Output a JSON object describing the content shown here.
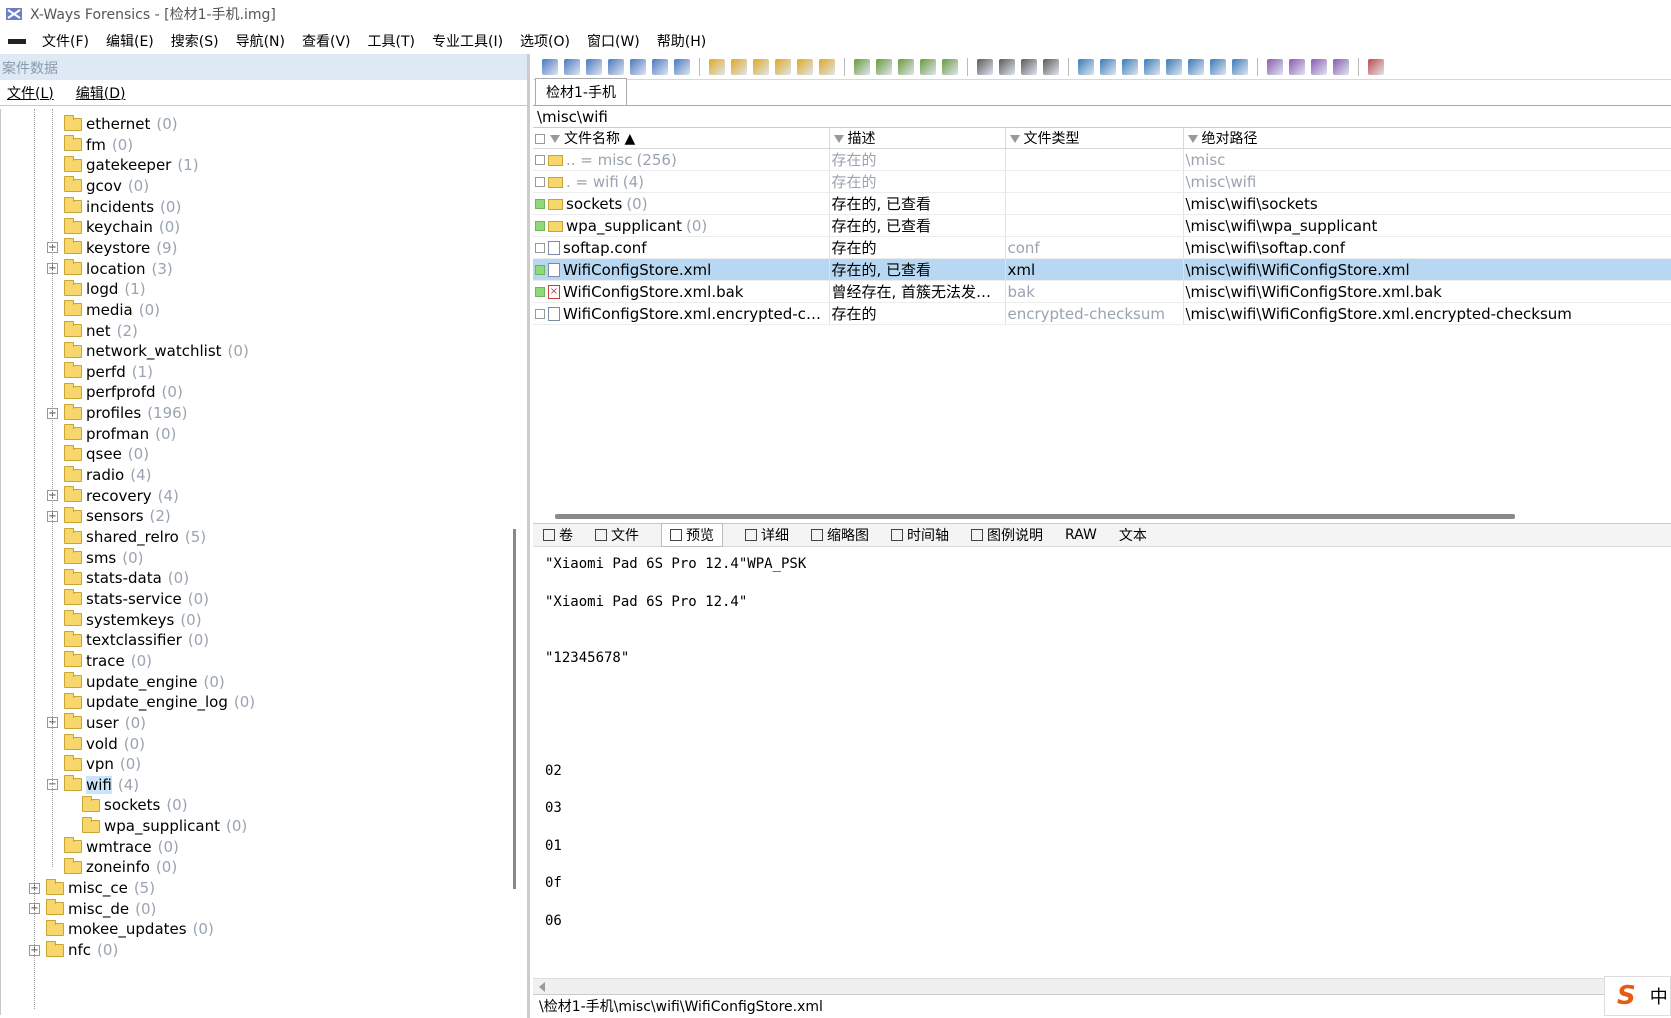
{
  "window": {
    "title": "X-Ways Forensics - [检材1-手机.img]"
  },
  "menu": [
    "文件(F)",
    "编辑(E)",
    "搜索(S)",
    "导航(N)",
    "查看(V)",
    "工具(T)",
    "专业工具(I)",
    "选项(O)",
    "窗口(W)",
    "帮助(H)"
  ],
  "case_panel": {
    "header": "案件数据",
    "menu": [
      "文件(L)",
      "编辑(D)"
    ]
  },
  "tree": [
    {
      "name": "ethernet",
      "count": "(0)",
      "level": 2,
      "expandable": false
    },
    {
      "name": "fm",
      "count": "(0)",
      "level": 2,
      "expandable": false
    },
    {
      "name": "gatekeeper",
      "count": "(1)",
      "level": 2,
      "expandable": false
    },
    {
      "name": "gcov",
      "count": "(0)",
      "level": 2,
      "expandable": false
    },
    {
      "name": "incidents",
      "count": "(0)",
      "level": 2,
      "expandable": false
    },
    {
      "name": "keychain",
      "count": "(0)",
      "level": 2,
      "expandable": false
    },
    {
      "name": "keystore",
      "count": "(9)",
      "level": 2,
      "expandable": true
    },
    {
      "name": "location",
      "count": "(3)",
      "level": 2,
      "expandable": true
    },
    {
      "name": "logd",
      "count": "(1)",
      "level": 2,
      "expandable": false
    },
    {
      "name": "media",
      "count": "(0)",
      "level": 2,
      "expandable": false
    },
    {
      "name": "net",
      "count": "(2)",
      "level": 2,
      "expandable": false
    },
    {
      "name": "network_watchlist",
      "count": "(0)",
      "level": 2,
      "expandable": false
    },
    {
      "name": "perfd",
      "count": "(1)",
      "level": 2,
      "expandable": false
    },
    {
      "name": "perfprofd",
      "count": "(0)",
      "level": 2,
      "expandable": false
    },
    {
      "name": "profiles",
      "count": "(196)",
      "level": 2,
      "expandable": true
    },
    {
      "name": "profman",
      "count": "(0)",
      "level": 2,
      "expandable": false
    },
    {
      "name": "qsee",
      "count": "(0)",
      "level": 2,
      "expandable": false
    },
    {
      "name": "radio",
      "count": "(4)",
      "level": 2,
      "expandable": false
    },
    {
      "name": "recovery",
      "count": "(4)",
      "level": 2,
      "expandable": true
    },
    {
      "name": "sensors",
      "count": "(2)",
      "level": 2,
      "expandable": true
    },
    {
      "name": "shared_relro",
      "count": "(5)",
      "level": 2,
      "expandable": false
    },
    {
      "name": "sms",
      "count": "(0)",
      "level": 2,
      "expandable": false
    },
    {
      "name": "stats-data",
      "count": "(0)",
      "level": 2,
      "expandable": false
    },
    {
      "name": "stats-service",
      "count": "(0)",
      "level": 2,
      "expandable": false
    },
    {
      "name": "systemkeys",
      "count": "(0)",
      "level": 2,
      "expandable": false
    },
    {
      "name": "textclassifier",
      "count": "(0)",
      "level": 2,
      "expandable": false
    },
    {
      "name": "trace",
      "count": "(0)",
      "level": 2,
      "expandable": false
    },
    {
      "name": "update_engine",
      "count": "(0)",
      "level": 2,
      "expandable": false
    },
    {
      "name": "update_engine_log",
      "count": "(0)",
      "level": 2,
      "expandable": false
    },
    {
      "name": "user",
      "count": "(0)",
      "level": 2,
      "expandable": true
    },
    {
      "name": "vold",
      "count": "(0)",
      "level": 2,
      "expandable": false
    },
    {
      "name": "vpn",
      "count": "(0)",
      "level": 2,
      "expandable": false
    },
    {
      "name": "wifi",
      "count": "(4)",
      "level": 2,
      "expandable": true,
      "expanded": true,
      "selected": true
    },
    {
      "name": "sockets",
      "count": "(0)",
      "level": 3,
      "expandable": false
    },
    {
      "name": "wpa_supplicant",
      "count": "(0)",
      "level": 3,
      "expandable": false
    },
    {
      "name": "wmtrace",
      "count": "(0)",
      "level": 2,
      "expandable": false
    },
    {
      "name": "zoneinfo",
      "count": "(0)",
      "level": 2,
      "expandable": false
    },
    {
      "name": "misc_ce",
      "count": "(5)",
      "level": 1,
      "expandable": true
    },
    {
      "name": "misc_de",
      "count": "(0)",
      "level": 1,
      "expandable": true
    },
    {
      "name": "mokee_updates",
      "count": "(0)",
      "level": 1,
      "expandable": false
    },
    {
      "name": "nfc",
      "count": "(0)",
      "level": 1,
      "expandable": true
    }
  ],
  "evidence_tab": "检材1-手机",
  "current_path": "\\misc\\wifi",
  "columns": [
    "文件名称",
    "描述",
    "文件类型",
    "绝对路径"
  ],
  "files": [
    {
      "name": "..  =  misc",
      "count": "(256)",
      "desc": "存在的",
      "type": "",
      "path": "\\misc",
      "grey": true,
      "icon": "folder",
      "check": ""
    },
    {
      "name": ".   =  wifi",
      "count": "(4)",
      "desc": "存在的",
      "type": "",
      "path": "\\misc\\wifi",
      "grey": true,
      "icon": "folder",
      "check": ""
    },
    {
      "name": "sockets",
      "count": "(0)",
      "desc": "存在的, 已查看",
      "type": "",
      "path": "\\misc\\wifi\\sockets",
      "grey": false,
      "icon": "folder",
      "check": "green"
    },
    {
      "name": "wpa_supplicant",
      "count": "(0)",
      "desc": "存在的, 已查看",
      "type": "",
      "path": "\\misc\\wifi\\wpa_supplicant",
      "grey": false,
      "icon": "folder",
      "check": "green"
    },
    {
      "name": "softap.conf",
      "count": "",
      "desc": "存在的",
      "type": "conf",
      "path": "\\misc\\wifi\\softap.conf",
      "grey": false,
      "icon": "file",
      "check": ""
    },
    {
      "name": "WifiConfigStore.xml",
      "count": "",
      "desc": "存在的, 已查看",
      "type": "xml",
      "path": "\\misc\\wifi\\WifiConfigStore.xml",
      "grey": false,
      "icon": "file",
      "check": "green",
      "selected": true
    },
    {
      "name": "WifiConfigStore.xml.bak",
      "count": "",
      "desc": "曾经存在, 首簇无法发现...",
      "type": "bak",
      "path": "\\misc\\wifi\\WifiConfigStore.xml.bak",
      "grey": false,
      "icon": "deleted",
      "check": "green"
    },
    {
      "name": "WifiConfigStore.xml.encrypted-che...",
      "count": "",
      "desc": "存在的",
      "type": "encrypted-checksum",
      "path": "\\misc\\wifi\\WifiConfigStore.xml.encrypted-checksum",
      "grey": false,
      "icon": "file",
      "check": ""
    }
  ],
  "view_tabs": [
    "卷",
    "文件",
    "预览",
    "详细",
    "缩略图",
    "时间轴",
    "图例说明",
    "RAW",
    "文本"
  ],
  "preview_lines": [
    "\"Xiaomi Pad 6S Pro 12.4\"WPA_PSK",
    "\"Xiaomi Pad 6S Pro 12.4\"",
    "\"12345678\"",
    "02",
    "03",
    "01",
    "0f",
    "06"
  ],
  "status_path": "\\检材1-手机\\misc\\wifi\\WifiConfigStore.xml",
  "ime": {
    "logo": "S",
    "mode": "中"
  },
  "colors": {
    "selection": "#b7d7f2",
    "viewed_check": "#8fd97a",
    "folder": "#f7d66b",
    "count_grey": "#9aa3b0"
  }
}
